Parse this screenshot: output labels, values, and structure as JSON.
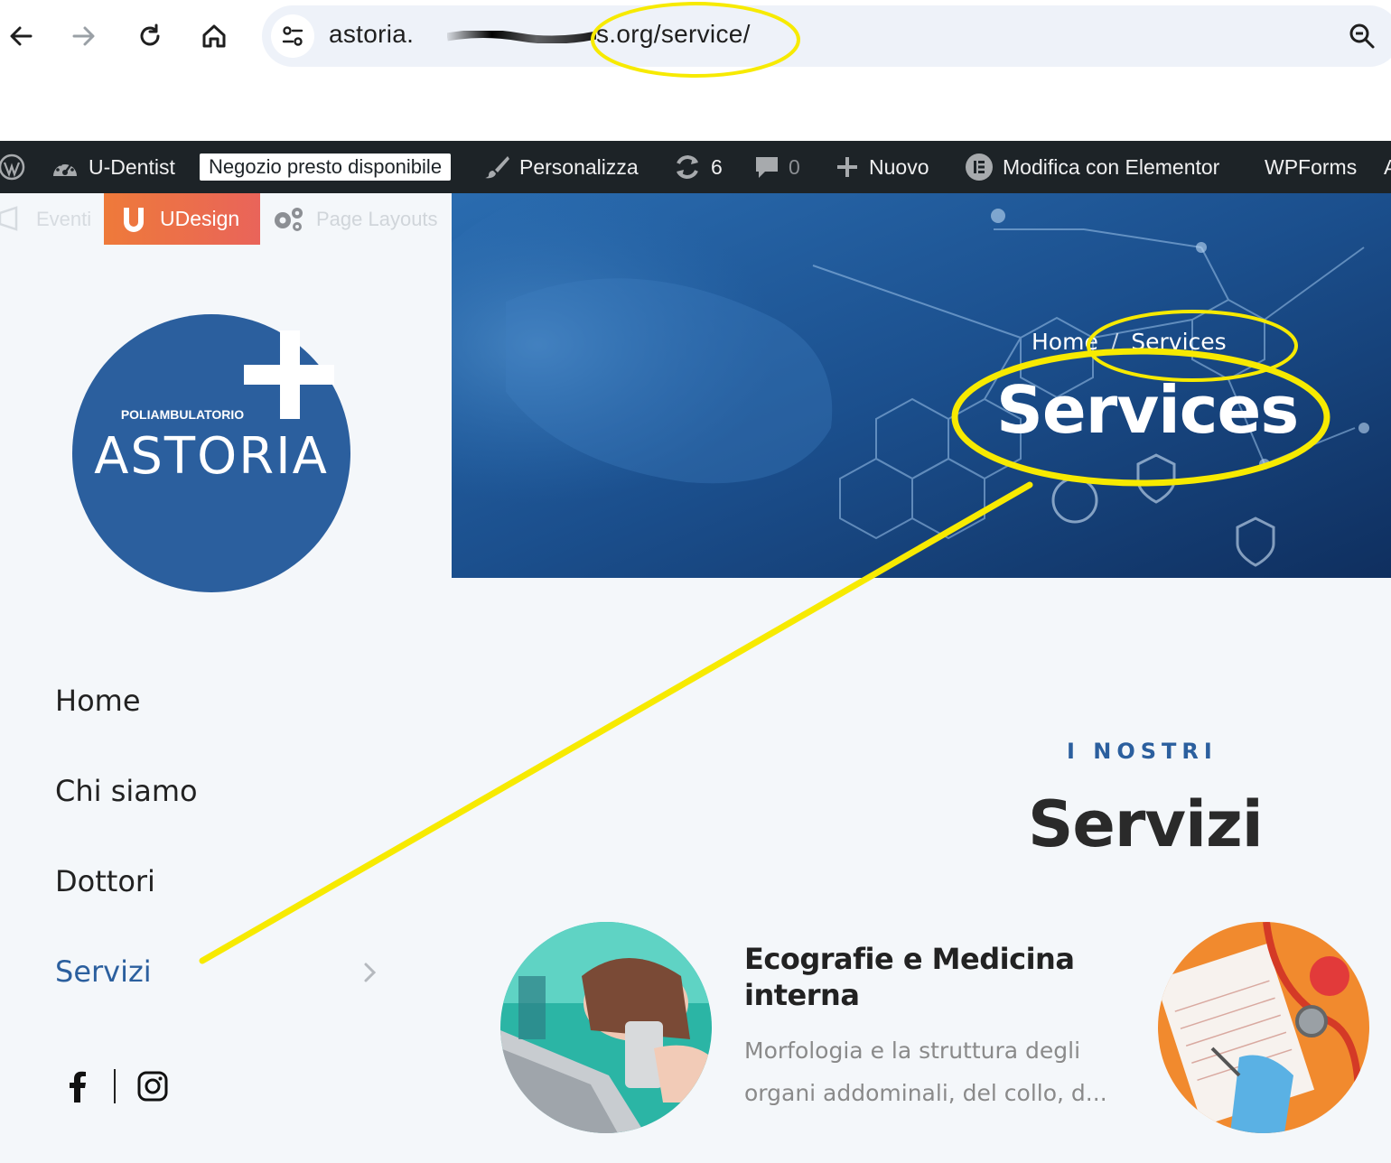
{
  "browser": {
    "url_host": "astoria.",
    "url_path": "s.org/service/"
  },
  "adminbar": {
    "site_name": "U-Dentist",
    "badge": "Negozio presto disponibile",
    "customize": "Personalizza",
    "updates_count": "6",
    "comments_count": "0",
    "new": "Nuovo",
    "elementor": "Modifica con Elementor",
    "wpforms": "WPForms",
    "overflow": "A"
  },
  "subbar": {
    "eventi": "Eventi",
    "udesign": "UDesign",
    "page_layouts": "Page Layouts"
  },
  "logo": {
    "subtitle": "POLIAMBULATORIO",
    "name": "ASTORIA",
    "color": "#2b5f9e"
  },
  "menu": {
    "items": [
      {
        "label": "Home"
      },
      {
        "label": "Chi siamo"
      },
      {
        "label": "Dottori"
      },
      {
        "label": "Servizi"
      }
    ]
  },
  "hero": {
    "breadcrumb_home": "Home",
    "breadcrumb_sep": "/",
    "breadcrumb_current": "Services",
    "title": "Services"
  },
  "section": {
    "eyebrow": "I NOSTRI",
    "title": "Servizi"
  },
  "card": {
    "title": "Ecografie e Medicina interna",
    "description": "Morfologia e la struttura degli organi addominali, del collo, d..."
  },
  "colors": {
    "accent": "#2b5f9e",
    "annotation": "#f7ea00",
    "adminbar": "#1d2327"
  }
}
